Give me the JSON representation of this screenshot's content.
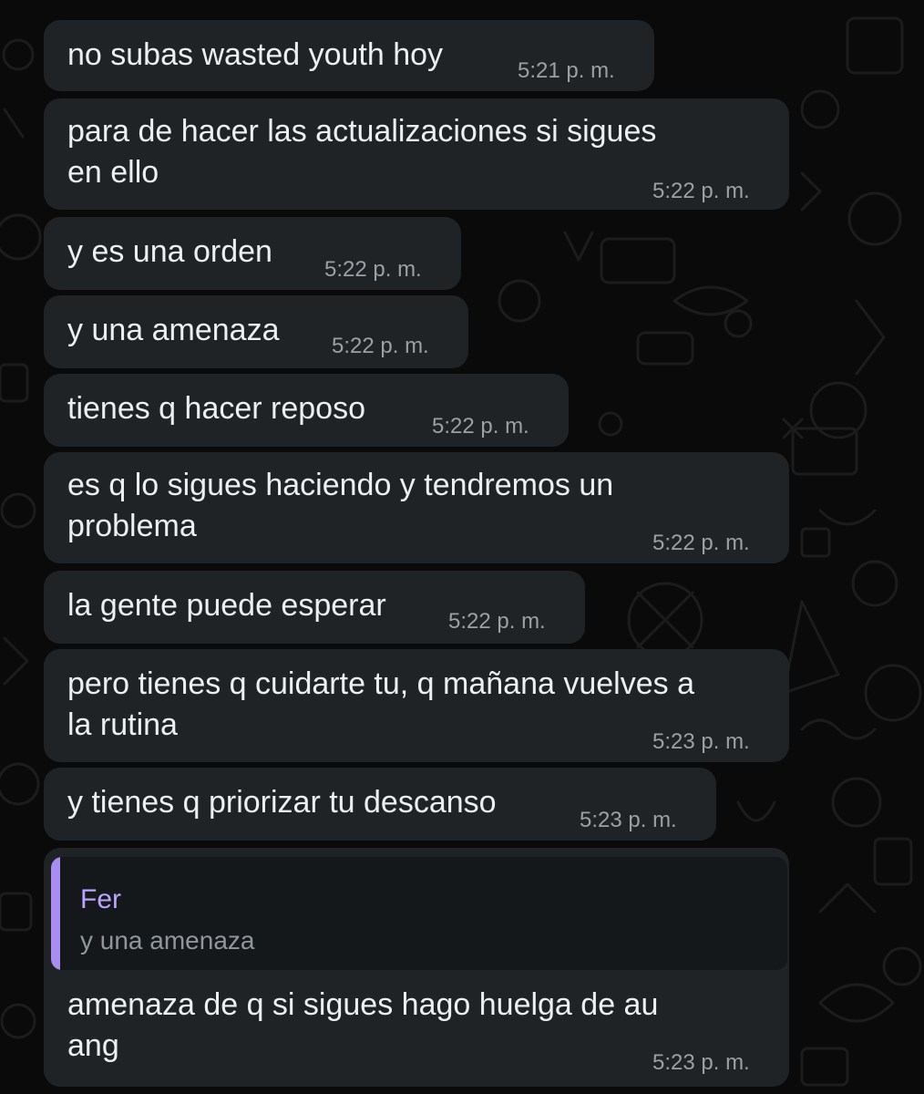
{
  "messages": [
    {
      "text": "no subas wasted youth hoy",
      "time": "5:21 p. m."
    },
    {
      "text": "para de hacer las actualizaciones si sigues\nen ello",
      "time": "5:22 p. m."
    },
    {
      "text": "y es una orden",
      "time": "5:22 p. m."
    },
    {
      "text": "y una amenaza",
      "time": "5:22 p. m."
    },
    {
      "text": "tienes q hacer reposo",
      "time": "5:22 p. m."
    },
    {
      "text": "es q lo sigues haciendo y tendremos un\nproblema",
      "time": "5:22 p. m."
    },
    {
      "text": "la gente puede esperar",
      "time": "5:22 p. m."
    },
    {
      "text": "pero tienes q cuidarte tu, q mañana vuelves a\nla rutina",
      "time": "5:23 p. m."
    },
    {
      "text": "y tienes q priorizar tu descanso",
      "time": "5:23 p. m."
    },
    {
      "reply_to": {
        "author": "Fer",
        "text": "y una amenaza"
      },
      "text": "amenaza de q si sigues hago huelga de au\nang",
      "time": "5:23 p. m."
    }
  ],
  "colors": {
    "background": "#0a0a0a",
    "bubble": "#1f2325",
    "text": "#eceff1",
    "time": "#9aa0a3",
    "quote_accent": "#a88ef0"
  }
}
